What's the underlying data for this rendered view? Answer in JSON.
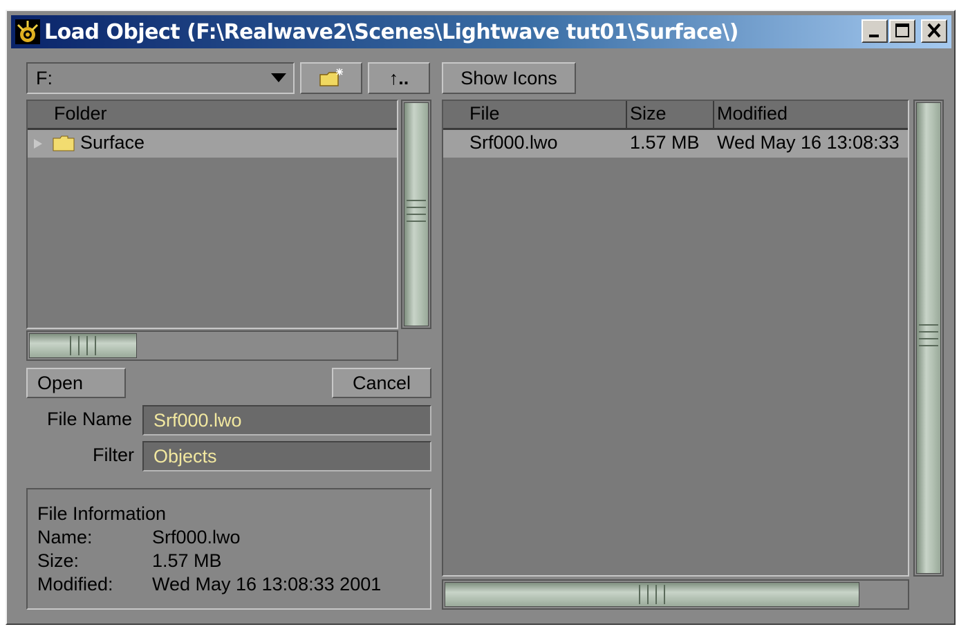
{
  "window": {
    "title": "Load Object (F:\\Realwave2\\Scenes\\Lightwave tut01\\Surface\\)"
  },
  "toolbar": {
    "drive_value": "F:",
    "new_folder_icon": "new-folder-icon",
    "parent_label": "↑..",
    "show_icons_label": "Show Icons"
  },
  "folder_pane": {
    "header": "Folder",
    "items": [
      {
        "label": "Surface",
        "icon": "folder-icon",
        "selected": true
      }
    ]
  },
  "file_pane": {
    "columns": [
      "File",
      "Size",
      "Modified"
    ],
    "rows": [
      {
        "file": "Srf000.lwo",
        "size": "1.57 MB",
        "modified": "Wed May 16 13:08:33"
      }
    ]
  },
  "actions": {
    "open_label": "Open",
    "cancel_label": "Cancel"
  },
  "form": {
    "file_name_label": "File Name",
    "file_name_value": "Srf000.lwo",
    "filter_label": "Filter",
    "filter_value": "Objects"
  },
  "file_info": {
    "heading": "File Information",
    "name_label": "Name:",
    "name_value": "Srf000.lwo",
    "size_label": "Size:",
    "size_value": "1.57 MB",
    "modified_label": "Modified:",
    "modified_value": "Wed May 16 13:08:33 2001"
  },
  "colors": {
    "title_gradient_start": "#0a246a",
    "title_gradient_end": "#a6caf0",
    "panel_background": "#888888",
    "field_text": "#f2e8a0"
  }
}
